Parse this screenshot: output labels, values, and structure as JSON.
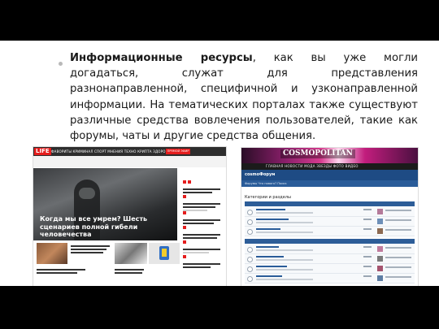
{
  "slide": {
    "lines": [
      {
        "bold": "Информационные ресурсы",
        "text": ", как вы уже могли догадаться, служат для представления разнонаправленной, специфичной и узконаправленной информации. На тематических порталах также существуют различные средства вовлечения пользователей, такие как форумы, чаты и другие средства общения."
      }
    ]
  },
  "life_screenshot": {
    "logo": "LIFE",
    "menu": "ФАВОРИТЫ  КРИМИНАЛ  СПОРТ  МНЕНИЯ  ТЕХНО  КРИПТА  ЗДОРОВЬЕ  ЕЩЁ",
    "live_button": "ПРЯМОЙ ЭФИР",
    "hero_title": "Когда мы все умрем? Шесть сценариев полной гибели человечества",
    "colors": {
      "brand_red": "#e41d1d",
      "nav_dark": "#2d2d2d"
    }
  },
  "cosmo_screenshot": {
    "logo": "COSMOPOLITAN",
    "nav": "ГЛАВНАЯ   НОВОСТИ   МОДА   ЗВЕЗДЫ   ФОТО   ВИДЕО",
    "brand": "cosmoФорум",
    "tabs": "Форумы   Что нового?   Поиск",
    "breadcrumb": "Категории и разделы",
    "colors": {
      "header_blue": "#1e4b84",
      "accent_pink": "#d63b8e"
    }
  }
}
